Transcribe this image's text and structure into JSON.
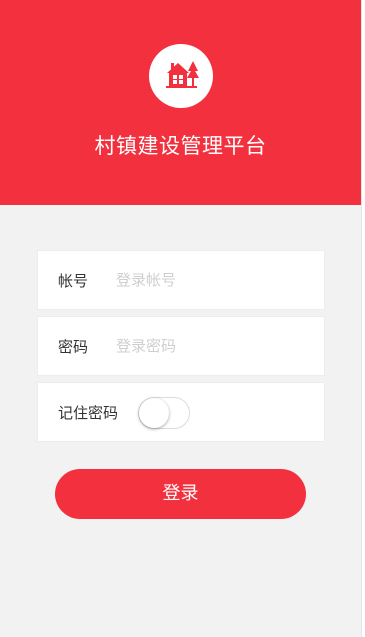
{
  "header": {
    "title": "村镇建设管理平台",
    "logo_icon": "house-with-tree-icon"
  },
  "form": {
    "account": {
      "label": "帐号",
      "placeholder": "登录帐号",
      "value": ""
    },
    "password": {
      "label": "密码",
      "placeholder": "登录密码",
      "value": ""
    },
    "remember": {
      "label": "记住密码",
      "checked": false
    },
    "submit_label": "登录"
  },
  "colors": {
    "accent": "#f2303e",
    "background": "#f2f2f2",
    "placeholder": "#cfcfcf"
  }
}
